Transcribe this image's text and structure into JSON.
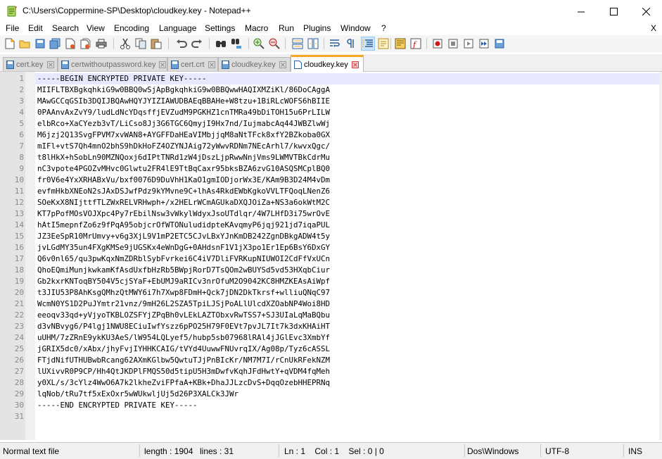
{
  "window": {
    "title": "C:\\Users\\Coppermine-SP\\Desktop\\cloudkey.key - Notepad++"
  },
  "menu": {
    "items": [
      "File",
      "Edit",
      "Search",
      "View",
      "Encoding",
      "Language",
      "Settings",
      "Macro",
      "Run",
      "Plugins",
      "Window",
      "?"
    ],
    "close_doc": "X"
  },
  "toolbar": {
    "buttons": [
      "new-file-icon",
      "open-file-icon",
      "save-icon",
      "save-all-icon",
      "close-icon",
      "close-all-icon",
      "print-icon",
      "cut-icon",
      "copy-icon",
      "paste-icon",
      "undo-icon",
      "redo-icon",
      "find-icon",
      "replace-icon",
      "zoom-in-icon",
      "zoom-out-icon",
      "sync-vertical-icon",
      "sync-horizontal-icon",
      "word-wrap-icon",
      "show-all-chars-icon",
      "indent-guide-icon",
      "define-language-icon",
      "doc-map-icon",
      "function-list-icon",
      "folder-workspace-icon",
      "record-macro-icon",
      "stop-record-icon",
      "playback-macro-icon",
      "run-macro-multiple-icon",
      "save-macro-icon"
    ]
  },
  "tabs": [
    {
      "label": "cert.key",
      "active": false
    },
    {
      "label": "certwithoutpassword.key",
      "active": false
    },
    {
      "label": "cert.crt",
      "active": false
    },
    {
      "label": "cloudkey.key",
      "active": false
    },
    {
      "label": "cloudkey.key",
      "active": true
    }
  ],
  "editor": {
    "lines": [
      "-----BEGIN ENCRYPTED PRIVATE KEY-----",
      "MIIFLTBXBgkqhkiG9w0BBQ0wSjApBgkqhkiG9w0BBQwwHAQIXMZiKl/86DoCAggA",
      "MAwGCCqGSIb3DQIJBQAwHQYJYIZIAWUDBAEqBBAHe+W8tzu+1BiRLcWOFS6hBIIE",
      "0PAAnvAxZvY9/ludLdNcYDqsffjEVZudM9PGKHZ1cnTMRa49bDiTOH15u6PrLILW",
      "elbRco+XaCYezb3vT/LiCso8Jj3G6TGC6QmyjI9Hx7nd/IujmabcAq44JWBZlwWj",
      "M6jzj2Q13SvgFPVM7xvWAN8+AYGFFDaHEaVIMbjjqM8aNtTFck8xfY2BZkoba0GX",
      "mIFl+vtS7Qh4mnO2bhS9hDkHoFZ4OZYNJAig72yWwvRDNm7NEcArhl7/kwvxQgc/",
      "t8lHkX+hSobLn90MZNQoxj6dIPtTNRd1zW4jDszLjpRwwNnjVms9LWMVTBkCdrMu",
      "nC3vpote4PGOZvMHvc0Glwtu2FR4lE9TtBqCaxr95bksBZA6zvG10ASQSMCplBQ0",
      "fr0V6e4YxXRHABxVu/bxf0076D9DuVhH1KaO1gmIODjorWx3E/KAm9B3D24M4vDm",
      "evfmHkbXNEoN2sJAxDSJwfPdz9kYMvne9C+lhAs4RkdEWbKgkoVVLTFQoqLNenZ6",
      "SOeKxX8NIjttfTLZWxRELVRHwph+/x2HELrWCmAGUkaDXQJOiZa+NS3a6okWtM2C",
      "KT7pPofMOsVOJXpc4Py7rEbilNsw3vWkylWdyxJsoUTdlqr/4W7LHfD3i75wrOvE",
      "hAtI5mepnfZo6z9fPqA95objcrOfWTONuludidpteKAvqmyP6jqj921jd7iqaPUL",
      "JZ3EeSpR10MrUmvy+v6g3XjL9V1mP2ETC5CJvLBxYJnKmDB242ZgnDBkgADW4t5y",
      "jvLGdMY35un4FXgKMSe9jUGSKx4eWnDgG+0AHdsnF1V1jX3po1Er1Ep6BsY6DxGY",
      "Q6v0nl65/qu3pwKqxNmZDRblSybFvrkei6C4iV7DliFVRKupNIUWOI2CdFfVxUCn",
      "QhoEQmiMunjkwkamKfAsdUxfbHzRb5BWpjRorD7TsQOm2wBUYSd5vd53HXqbCiur",
      "Gb2kxrKNToqBY504V5cjSYaF+EbUMJ9aRICv3nrOfuM2O9042KC8HMZKEAsAiWpf",
      "t3JIU53P8AhKsgQMhzQtMWY6i7h7Xwp8FDmH+Qck7jDN2DkTkrsf+wlliuQNqC97",
      "WcmN0YS1D2PuJYmtr21vnz/9mH26L2SZA5TpiLJSjPoALlUlcdXZOabNP4Woi8HD",
      "eeoqv33qd+yVjyoTKBLOZSFYjZPqBh0vLEkLAZTObxvRwTSS7+SJ3UIaLqMaBQbu",
      "d3vNBvyg6/P4lgj1NWU8ECiuIwfYszz6pPO25H79F0EVt7pvJL7It7k3dxKHAiHT",
      "uUHM/7zZRnE9ykKU3AeS/lW954LQLyef5/hubp5sb07968lRAl4jJGlEvc3XmbYf",
      "jGRIX5dc0/xAbx/jhyFvjIYHHKCAIG/tVYd4UuwwFNUvrqIX/Ag08p/Tyz6cASSL",
      "FTjdNifUTHUBwbRcang62AXmKGlbw5QwtuTJjPnBIcKr/NM7M7I/rCnUkRFekNZM",
      "lUXivvR0P9CP/Hh4QtJKDPlFMQS50d5tipU5H3mDwfvKqhJFdHwtY+qVDM4fqMeh",
      "y0XL/s/3cYlz4WwO6A7k2lkheZviFPfaA+KBk+DhaJJLzcDvS+DqqOzebHHEPRNq",
      "lqNob/tRu7tf5xExOxr5wWUkwljUj5d26P3XALCk3JWr",
      "-----END ENCRYPTED PRIVATE KEY-----",
      ""
    ]
  },
  "status": {
    "doc_type": "Normal text file",
    "length": "length : 1904",
    "lines": "lines : 31",
    "position": "Ln : 1    Col : 1    Sel : 0 | 0",
    "eol": "Dos\\Windows",
    "encoding": "UTF-8",
    "mode": "INS"
  },
  "colors": {
    "active_tab_accent": "#f5a623",
    "current_line": "#e8e8ff",
    "gutter": "#e4e4e4"
  }
}
